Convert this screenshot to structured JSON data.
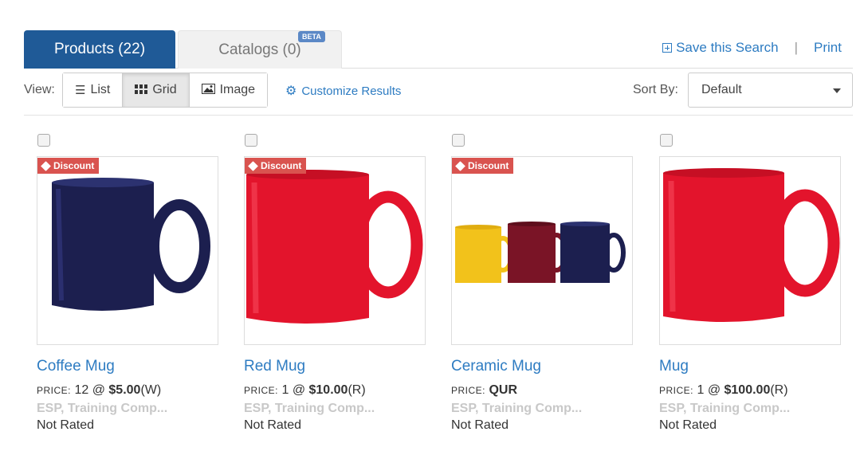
{
  "tabs": {
    "products": "Products (22)",
    "catalogs": "Catalogs (0)",
    "beta": "BETA"
  },
  "links": {
    "save_search": "Save this Search",
    "separator": "|",
    "print": "Print"
  },
  "view": {
    "label": "View:",
    "list": "List",
    "grid": "Grid",
    "image": "Image",
    "customize": "Customize Results",
    "active": "Grid"
  },
  "sort": {
    "label": "Sort By:",
    "value": "Default"
  },
  "colors": {
    "accent": "#1f5a97",
    "link": "#2e7cc2",
    "badge": "#d9534f"
  },
  "products": [
    {
      "name": "Coffee Mug",
      "price_label": "PRICE:",
      "price_qty": "12 @ ",
      "price_value": "$5.00",
      "price_code": "(W)",
      "supplier": "ESP, Training Comp...",
      "rating": "Not Rated",
      "badge": "Discount",
      "color": "#1c1f4f"
    },
    {
      "name": "Red Mug",
      "price_label": "PRICE:",
      "price_qty": "1 @ ",
      "price_value": "$10.00",
      "price_code": "(R)",
      "supplier": "ESP, Training Comp...",
      "rating": "Not Rated",
      "badge": "Discount",
      "color": "#e3142c"
    },
    {
      "name": "Ceramic Mug",
      "price_label": "PRICE:",
      "price_qty": "",
      "price_value": "QUR",
      "price_code": "",
      "supplier": "ESP, Training Comp...",
      "rating": "Not Rated",
      "badge": "Discount",
      "color": "#7a1426"
    },
    {
      "name": "Mug",
      "price_label": "PRICE:",
      "price_qty": "1 @ ",
      "price_value": "$100.00",
      "price_code": "(R)",
      "supplier": "ESP, Training Comp...",
      "rating": "Not Rated",
      "badge": "",
      "color": "#e3142c"
    }
  ]
}
